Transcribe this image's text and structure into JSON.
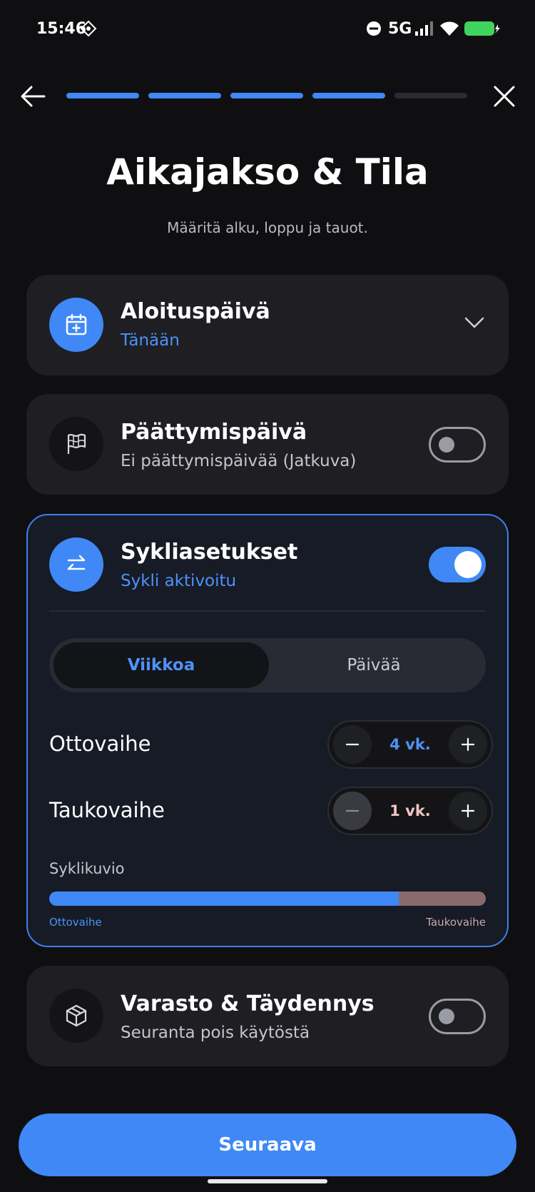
{
  "status": {
    "time": "15:46",
    "network": "5G"
  },
  "progress": {
    "steps_total": 5,
    "steps_done": 4,
    "active_color": "#3f88f6",
    "inactive_color": "#2a2b30"
  },
  "header": {
    "title": "Aikajakso & Tila",
    "subtitle": "Määritä alku, loppu ja tauot."
  },
  "start_date": {
    "title": "Aloituspäivä",
    "value": "Tänään"
  },
  "end_date": {
    "title": "Päättymispäivä",
    "value": "Ei päättymispäivää (Jatkuva)",
    "enabled": false
  },
  "cycle": {
    "title": "Sykliasetukset",
    "status": "Sykli aktivoitu",
    "enabled": true,
    "unit_tabs": [
      "Viikkoa",
      "Päivää"
    ],
    "selected_unit": "Viikkoa",
    "intake": {
      "label": "Ottovaihe",
      "value": "4 vk."
    },
    "pause": {
      "label": "Taukovaihe",
      "value": "1 vk."
    },
    "pattern": {
      "label": "Syklikuvio",
      "intake_label": "Ottovaihe",
      "pause_label": "Taukovaihe",
      "intake_fraction": 0.8
    }
  },
  "inventory": {
    "title": "Varasto & Täydennys",
    "status": "Seuranta pois käytöstä",
    "enabled": false
  },
  "cta": {
    "label": "Seuraava"
  },
  "colors": {
    "accent": "#3f88f6",
    "card": "#1e1e23",
    "active_card": "#161b26",
    "pause_value": "#f0c4c4"
  }
}
